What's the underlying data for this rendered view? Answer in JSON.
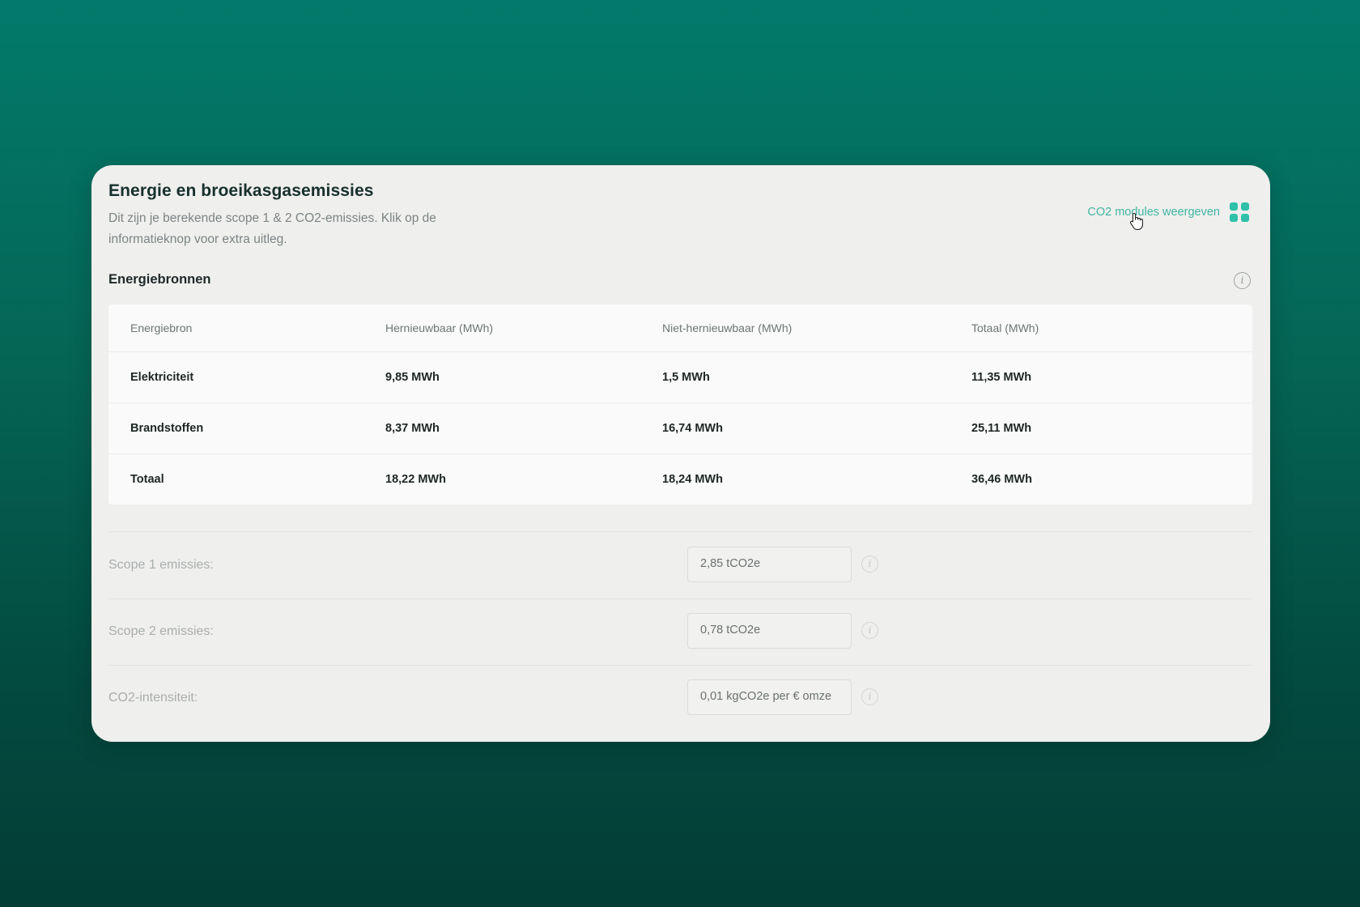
{
  "card": {
    "title": "Energie en broeikasgasemissies",
    "subtitle": "Dit zijn je berekende scope 1 & 2 CO2-emissies. Klik op de informatieknop voor extra uitleg.",
    "modules_link_label": "CO2 modules weergeven",
    "modules_icon": "grid-icon"
  },
  "energy_sources": {
    "title": "Energiebronnen",
    "info_icon": "info-icon",
    "columns": [
      "Energiebron",
      "Hernieuwbaar (MWh)",
      "Niet-hernieuwbaar (MWh)",
      "Totaal (MWh)"
    ],
    "rows": [
      [
        "Elektriciteit",
        "9,85 MWh",
        "1,5 MWh",
        "11,35 MWh"
      ],
      [
        "Brandstoffen",
        "8,37 MWh",
        "16,74 MWh",
        "25,11 MWh"
      ],
      [
        "Totaal",
        "18,22 MWh",
        "18,24 MWh",
        "36,46 MWh"
      ]
    ]
  },
  "emissions": [
    {
      "label": "Scope 1 emissies:",
      "value": "2,85 tCO2e"
    },
    {
      "label": "Scope 2 emissies:",
      "value": "0,78 tCO2e"
    },
    {
      "label": "CO2-intensiteit:",
      "value": "0,01 kgCO2e per € omze"
    }
  ],
  "colors": {
    "background_top": "#027a6b",
    "background_bottom": "#033d35",
    "accent": "#2ec0a8",
    "link": "#3fb6a2",
    "card": "#efefee"
  }
}
